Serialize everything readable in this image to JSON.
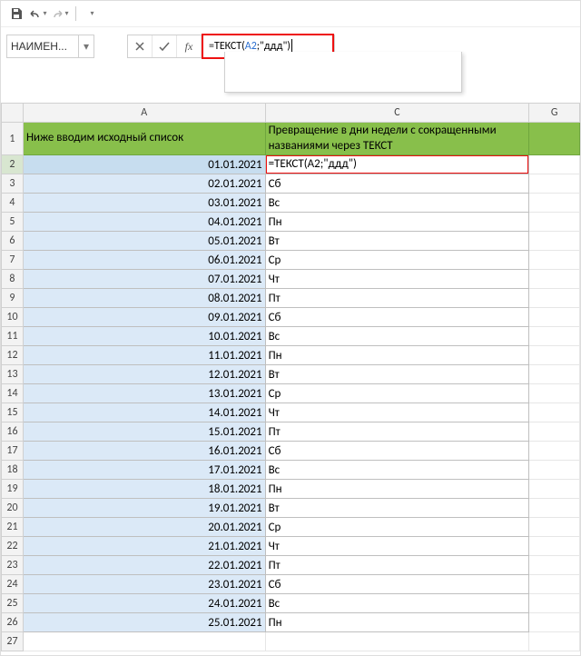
{
  "qat": {
    "save": "save-icon",
    "undo": "undo-icon",
    "redo": "redo-icon",
    "dropdown": "▾"
  },
  "namebox": {
    "value": "НАИМЕН..."
  },
  "formula": {
    "prefix": "=ТЕКСТ(",
    "ref": "A2",
    "suffix": ";\"ддд\")"
  },
  "columns": {
    "A": "A",
    "C": "C",
    "G": "G"
  },
  "header": {
    "A": "Ниже вводим исходный список",
    "C": "Превращение в дни недели с сокращенными названиями через ТЕКСТ"
  },
  "rows": [
    {
      "n": 2,
      "A": "01.01.2021",
      "C": "=ТЕКСТ(A2;\"ддд\")"
    },
    {
      "n": 3,
      "A": "02.01.2021",
      "C": "Сб"
    },
    {
      "n": 4,
      "A": "03.01.2021",
      "C": "Вс"
    },
    {
      "n": 5,
      "A": "04.01.2021",
      "C": "Пн"
    },
    {
      "n": 6,
      "A": "05.01.2021",
      "C": "Вт"
    },
    {
      "n": 7,
      "A": "06.01.2021",
      "C": "Ср"
    },
    {
      "n": 8,
      "A": "07.01.2021",
      "C": "Чт"
    },
    {
      "n": 9,
      "A": "08.01.2021",
      "C": "Пт"
    },
    {
      "n": 10,
      "A": "09.01.2021",
      "C": "Сб"
    },
    {
      "n": 11,
      "A": "10.01.2021",
      "C": "Вс"
    },
    {
      "n": 12,
      "A": "11.01.2021",
      "C": "Пн"
    },
    {
      "n": 13,
      "A": "12.01.2021",
      "C": "Вт"
    },
    {
      "n": 14,
      "A": "13.01.2021",
      "C": "Ср"
    },
    {
      "n": 15,
      "A": "14.01.2021",
      "C": "Чт"
    },
    {
      "n": 16,
      "A": "15.01.2021",
      "C": "Пт"
    },
    {
      "n": 17,
      "A": "16.01.2021",
      "C": "Сб"
    },
    {
      "n": 18,
      "A": "17.01.2021",
      "C": "Вс"
    },
    {
      "n": 19,
      "A": "18.01.2021",
      "C": "Пн"
    },
    {
      "n": 20,
      "A": "19.01.2021",
      "C": "Вт"
    },
    {
      "n": 21,
      "A": "20.01.2021",
      "C": "Ср"
    },
    {
      "n": 22,
      "A": "21.01.2021",
      "C": "Чт"
    },
    {
      "n": 23,
      "A": "22.01.2021",
      "C": "Пт"
    },
    {
      "n": 24,
      "A": "23.01.2021",
      "C": "Сб"
    },
    {
      "n": 25,
      "A": "24.01.2021",
      "C": "Вс"
    },
    {
      "n": 26,
      "A": "25.01.2021",
      "C": "Пн"
    },
    {
      "n": 27,
      "A": "",
      "C": ""
    }
  ]
}
